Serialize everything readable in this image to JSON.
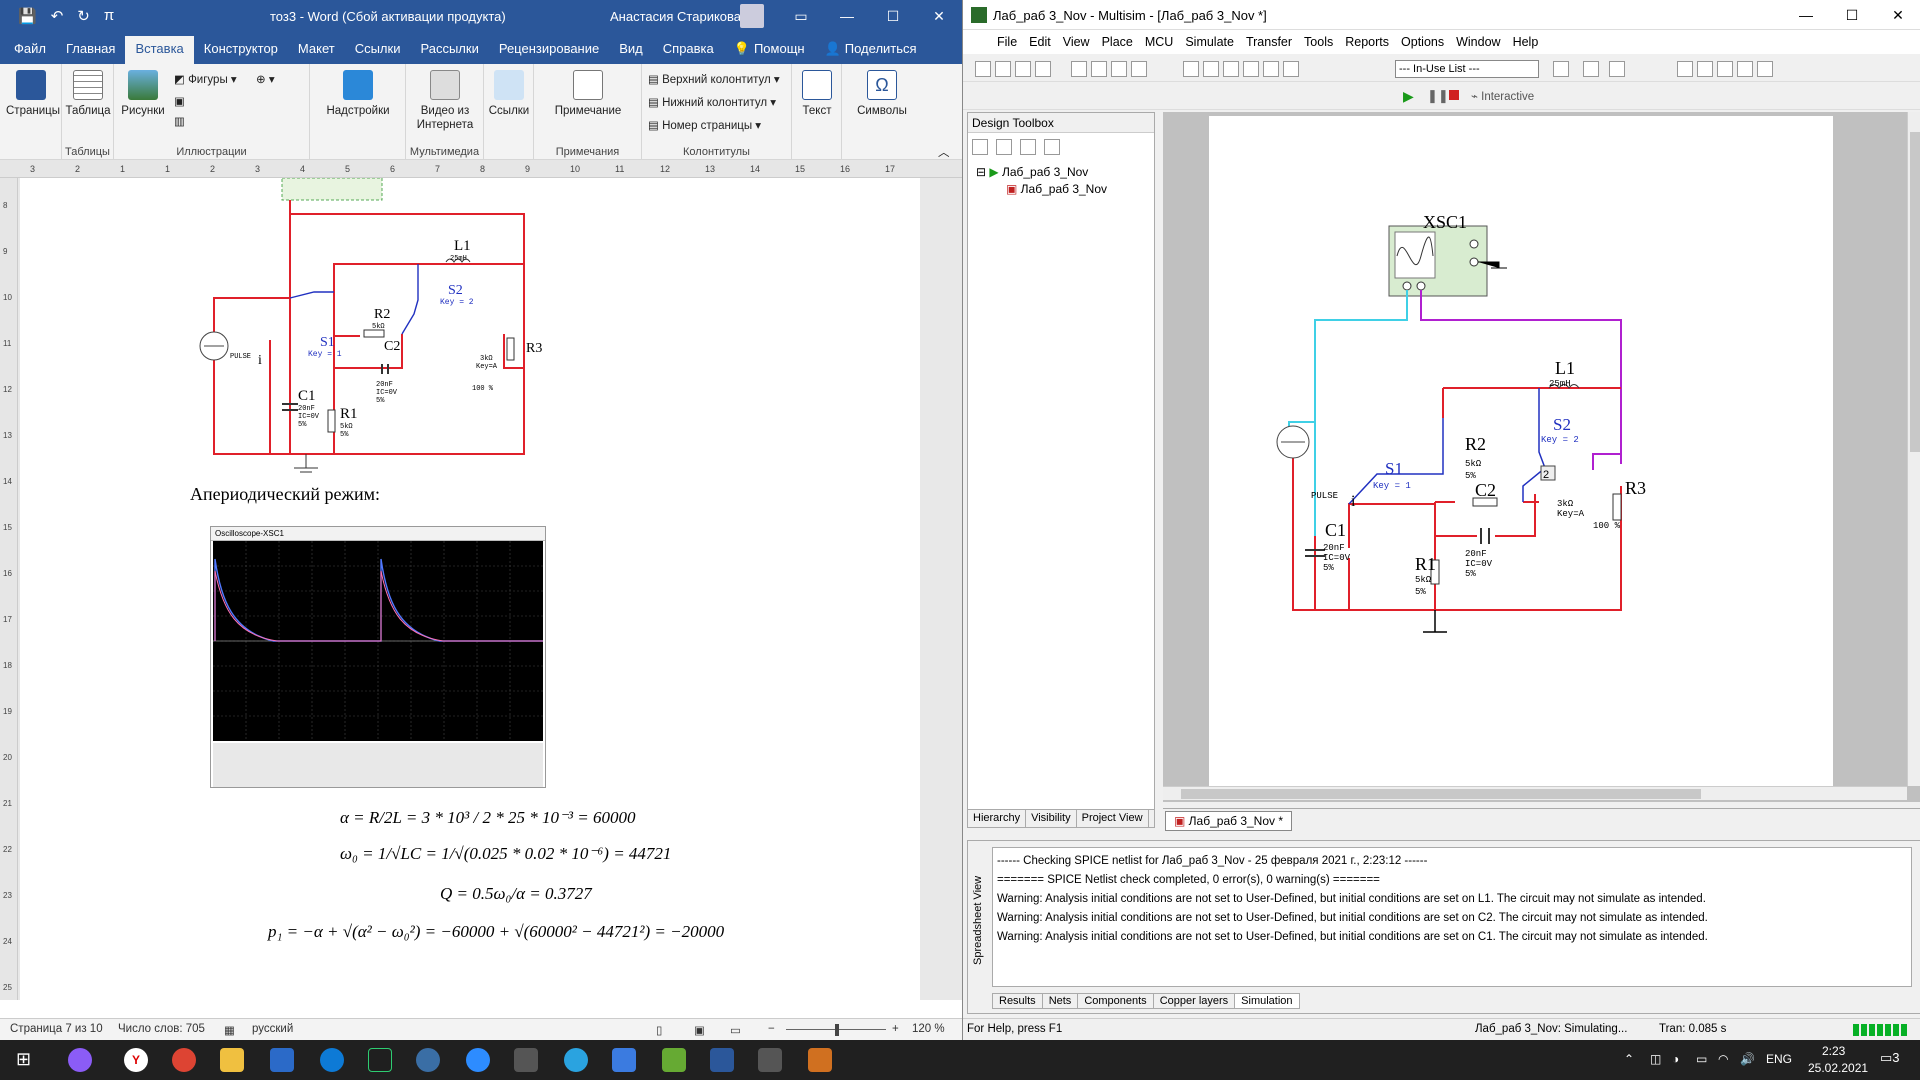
{
  "word": {
    "quick_access": [
      "💾",
      "↶",
      "↻",
      "π"
    ],
    "doc_title": "тоз3 - Word (Сбой активации продукта)",
    "user_name": "Анастасия Старикова",
    "tabs": [
      "Файл",
      "Главная",
      "Вставка",
      "Конструктор",
      "Макет",
      "Ссылки",
      "Рассылки",
      "Рецензирование",
      "Вид",
      "Справка",
      "Помощн",
      "Поделиться"
    ],
    "active_tab": "Вставка",
    "ribbon": {
      "pages": "Страницы",
      "table": "Таблица",
      "pictures": "Рисунки",
      "shapes": "Фигуры",
      "addins": "Надстройки",
      "video": "Видео из Интернета",
      "links": "Ссылки",
      "comment": "Примечание",
      "header": "Верхний колонтитул",
      "footer": "Нижний колонтитул",
      "page_number": "Номер страницы",
      "text": "Текст",
      "symbols": "Символы",
      "groups": [
        "Таблицы",
        "Иллюстрации",
        "Мультимедиа",
        "Примечания",
        "Колонтитулы"
      ]
    },
    "ruler_numbers": [
      "3",
      "2",
      "1",
      "1",
      "2",
      "3",
      "4",
      "5",
      "6",
      "7",
      "8",
      "9",
      "10",
      "11",
      "12",
      "13",
      "14",
      "15",
      "16",
      "17"
    ],
    "vruler_numbers": [
      "8",
      "9",
      "10",
      "11",
      "12",
      "13",
      "14",
      "15",
      "16",
      "17",
      "18",
      "19",
      "20",
      "21",
      "22",
      "23",
      "24",
      "25"
    ],
    "body": {
      "heading": "Апериодический режим:",
      "osc_title": "Oscilloscope-XSC1",
      "eq_alpha": "α = R/2L = 3 * 10³ / 2 * 25 * 10⁻³ = 60000",
      "eq_omega": "ω₀ = 1/√LC = 1/√(0.025 * 0.02 * 10⁻⁶) = 44721",
      "eq_q": "Q = 0.5ω₀/α = 0.3727",
      "eq_p": "p₁ = −α + √(α² − ω₀²) = −60000 + √(60000² − 44721²) = −20000"
    },
    "schematic_labels": {
      "l1": "L1",
      "l1v": "25mH",
      "s1": "S1",
      "s1k": "Key = 1",
      "s2": "S2",
      "s2k": "Key = 2",
      "r2": "R2",
      "r2v": "5kΩ",
      "r2t": "5%",
      "c2": "C2",
      "c2v": "20nF",
      "c2ic": "IC=0V",
      "c2t": "5%",
      "r3": "R3",
      "r3v": "3kΩ",
      "r3k": "Key=A",
      "r3p": "100 %",
      "c1": "C1",
      "c1v": "20nF",
      "c1ic": "IC=0V",
      "c1t": "5%",
      "r1": "R1",
      "r1v": "5kΩ",
      "r1t": "5%",
      "src": "PULSE",
      "i": "i"
    },
    "status": {
      "page": "Страница 7 из 10",
      "words": "Число слов: 705",
      "lang": "русский",
      "zoom": "120 %"
    }
  },
  "multisim": {
    "title": "Лаб_раб 3_Nov - Multisim - [Лаб_раб 3_Nov *]",
    "menu": [
      "File",
      "Edit",
      "View",
      "Place",
      "MCU",
      "Simulate",
      "Transfer",
      "Tools",
      "Reports",
      "Options",
      "Window",
      "Help"
    ],
    "inuse_list": "--- In-Use List ---",
    "interactive": "Interactive",
    "design_toolbox": "Design Toolbox",
    "tree_root": "Лаб_раб 3_Nov",
    "tree_child": "Лаб_раб 3_Nov",
    "toolbox_tabs": [
      "Hierarchy",
      "Visibility",
      "Project View"
    ],
    "sheet_tab": "Лаб_раб 3_Nov *",
    "schematic": {
      "xsc": "XSC1",
      "l1": "L1",
      "l1v": "25mH",
      "s1": "S1",
      "s1k": "Key = 1",
      "s2": "S2",
      "s2k": "Key = 2",
      "r2": "R2",
      "r2v": "5kΩ",
      "r2t": "5%",
      "c2": "C2",
      "c2v": "20nF",
      "c2ic": "IC=0V",
      "c2t": "5%",
      "r3": "R3",
      "r3v": "3kΩ",
      "r3k": "Key=A",
      "r3p": "100 %",
      "c1": "C1",
      "c1v": "20nF",
      "c1ic": "IC=0V",
      "c1t": "5%",
      "r1": "R1",
      "r1v": "5kΩ",
      "r1t": "5%",
      "src": "PULSE",
      "i": "i"
    },
    "spreadsheet": {
      "label": "Spreadsheet View",
      "lines": [
        "------ Checking SPICE netlist for Лаб_раб 3_Nov - 25 февраля 2021 г., 2:23:12 ------",
        "======= SPICE Netlist check completed, 0 error(s), 0 warning(s) =======",
        "Warning: Analysis initial conditions are not set to User-Defined, but initial conditions are set on L1. The circuit may not simulate as intended.",
        "Warning: Analysis initial conditions are not set to User-Defined, but initial conditions are set on C2. The circuit may not simulate as intended.",
        "Warning: Analysis initial conditions are not set to User-Defined, but initial conditions are set on C1. The circuit may not simulate as intended."
      ],
      "tabs": [
        "Results",
        "Nets",
        "Components",
        "Copper layers",
        "Simulation"
      ]
    },
    "status": {
      "help": "For Help, press F1",
      "sim": "Лаб_раб 3_Nov: Simulating...",
      "tran": "Tran: 0.085 s"
    }
  },
  "taskbar": {
    "lang": "ENG",
    "time": "2:23",
    "date": "25.02.2021",
    "notif": "3"
  },
  "colors": {
    "word_blue": "#2b579a",
    "wire_red": "#e0202a",
    "wire_cyan": "#3fd0e6",
    "wire_magenta": "#b020d0",
    "switch_blue": "#2030c0",
    "trace_blue": "#5078ff",
    "trace_pink": "#ff70b0"
  }
}
